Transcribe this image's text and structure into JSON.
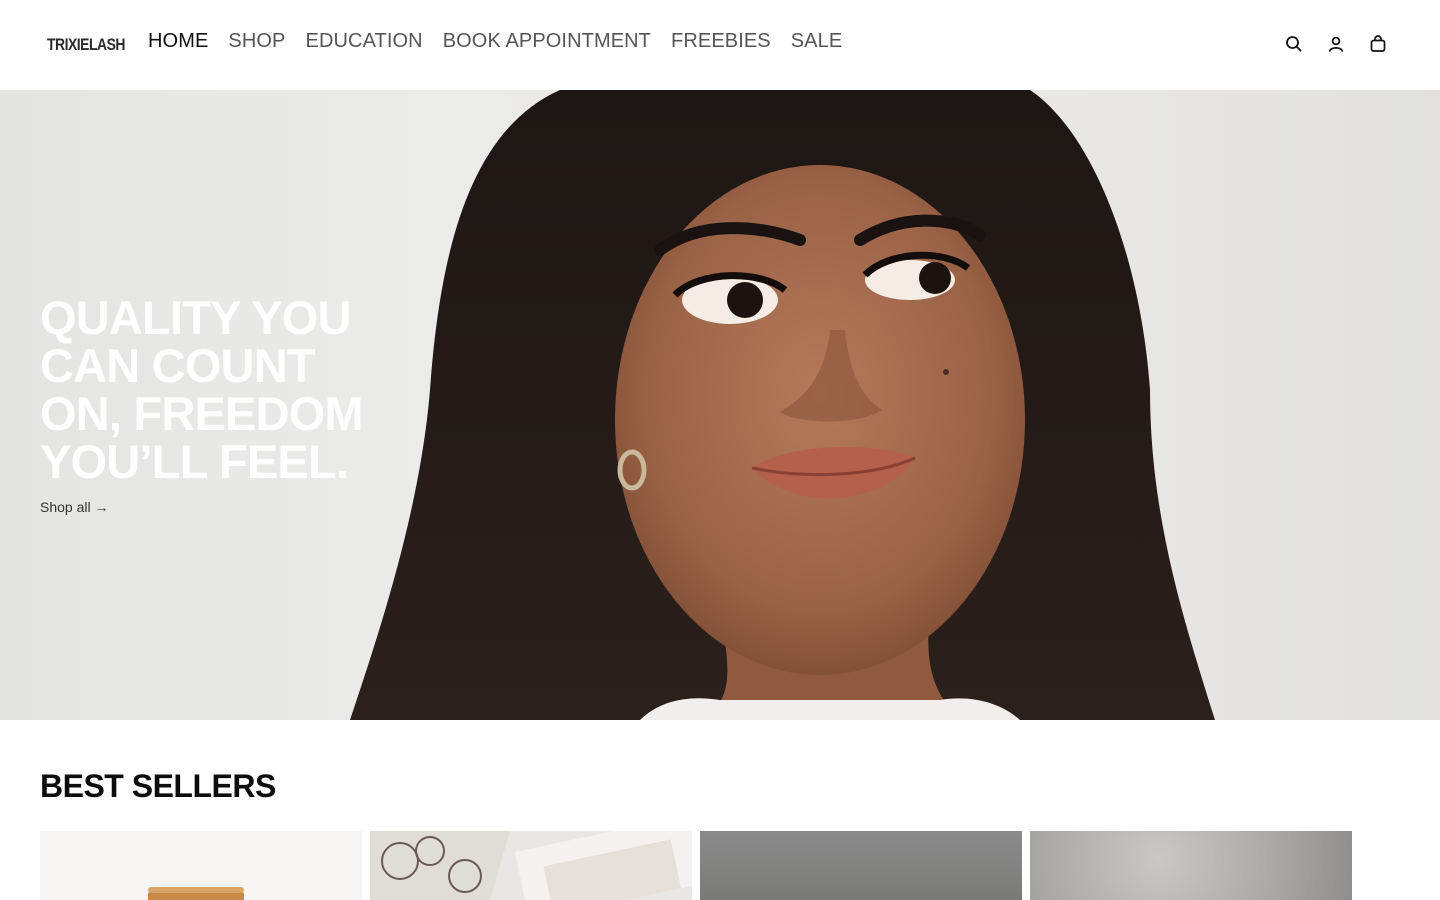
{
  "brand": {
    "logo_text": "TRIXIELASH"
  },
  "nav": {
    "items": [
      {
        "label": "HOME",
        "active": true
      },
      {
        "label": "SHOP",
        "active": false
      },
      {
        "label": "EDUCATION",
        "active": false
      },
      {
        "label": "BOOK APPOINTMENT",
        "active": false
      },
      {
        "label": "FREEBIES",
        "active": false
      },
      {
        "label": "SALE",
        "active": false
      }
    ]
  },
  "header_icons": [
    "search-icon",
    "account-icon",
    "cart-icon"
  ],
  "hero": {
    "heading_lines": [
      "QUALITY YOU",
      "CAN COUNT",
      "ON, FREEDOM",
      "YOU’LL FEEL."
    ],
    "cta": "Shop all →"
  },
  "best_sellers": {
    "title": "BEST SELLERS",
    "products": [
      {
        "id": 1
      },
      {
        "id": 2
      },
      {
        "id": 3
      },
      {
        "id": 4
      }
    ]
  },
  "colors": {
    "text": "#111111",
    "nav_inactive": "#555555",
    "hero_text": "#ffffff",
    "background": "#ffffff"
  }
}
